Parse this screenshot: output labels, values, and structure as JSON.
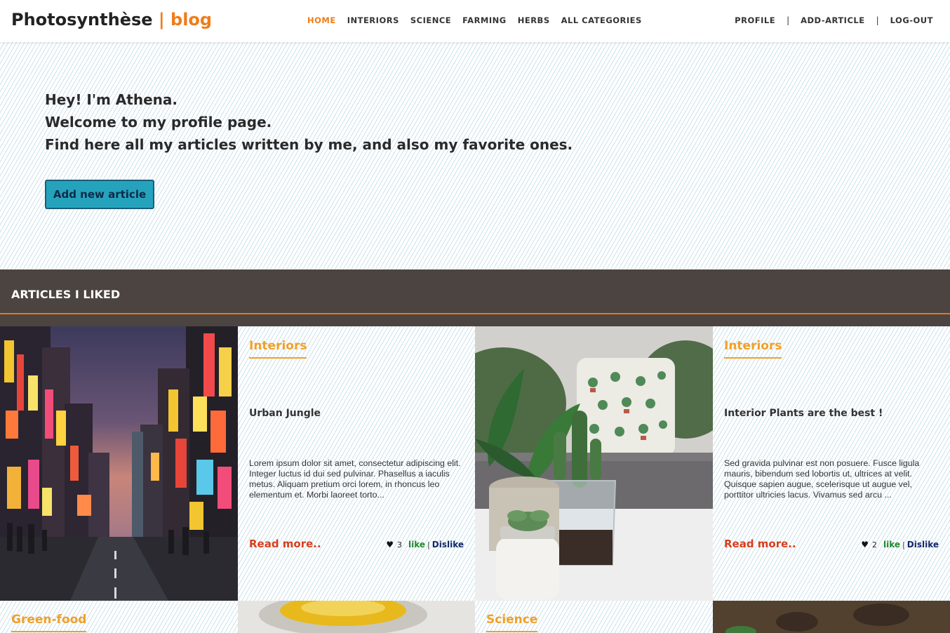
{
  "brand": {
    "name": "Photosynthèse",
    "suffix": "| blog"
  },
  "nav": {
    "items": [
      {
        "label": "HOME"
      },
      {
        "label": "INTERIORS"
      },
      {
        "label": "SCIENCE"
      },
      {
        "label": "FARMING"
      },
      {
        "label": "HERBS"
      },
      {
        "label": "ALL CATEGORIES"
      }
    ],
    "right": {
      "profile": "PROFILE",
      "sep": "|",
      "add": "ADD-ARTICLE",
      "logout": "LOG-OUT"
    }
  },
  "hero": {
    "line1": "Hey! I'm Athena.",
    "line2": "Welcome to my profile page.",
    "line3": "Find here all my articles written by me, and also my favorite ones.",
    "button": "Add new article"
  },
  "section": {
    "title": "ARTICLES I LIKED"
  },
  "cards": [
    {
      "category": "Interiors",
      "title": "Urban Jungle",
      "excerpt": "Lorem ipsum dolor sit amet, consectetur adipiscing elit. Integer luctus id dui sed pulvinar. Phasellus a iaculis metus. Aliquam pretium orci lorem, in rhoncus leo elementum et. Morbi laoreet torto...",
      "read_more": "Read more..",
      "likes": "3",
      "like": "like",
      "separator": "|",
      "dislike": "Dislike"
    },
    {
      "category": "Interiors",
      "title": "Interior Plants are the best !",
      "excerpt": "Sed gravida pulvinar est non posuere. Fusce ligula mauris, bibendum sed lobortis ut, ultrices at velit. Quisque sapien augue, scelerisque ut augue vel, porttitor ultricies lacus. Vivamus sed arcu ...",
      "read_more": "Read more..",
      "likes": "2",
      "like": "like",
      "separator": "|",
      "dislike": "Dislike"
    }
  ],
  "next_row": {
    "cat1": "Green-food",
    "cat2": "Science"
  },
  "colors": {
    "accent": "#ef7d1a",
    "category": "#f0a02a",
    "read_more": "#d6401f",
    "button": "#25a3bd",
    "section_bg": "#4c4440",
    "like": "#1f8a2e",
    "dislike": "#13286b"
  }
}
